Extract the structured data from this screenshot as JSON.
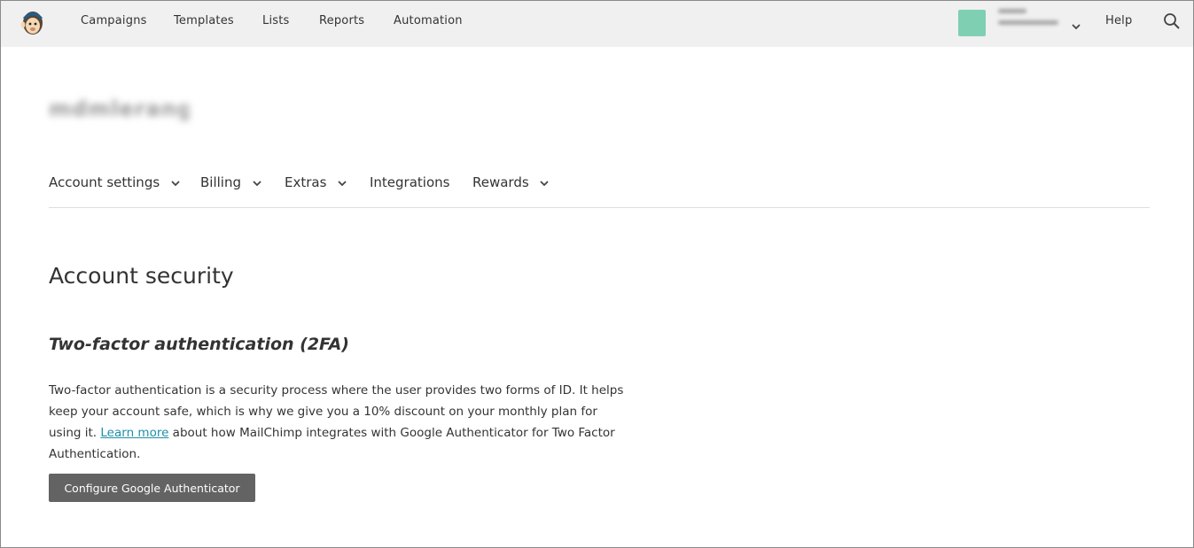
{
  "topnav": {
    "items": [
      "Campaigns",
      "Templates",
      "Lists",
      "Reports",
      "Automation"
    ],
    "help_label": "Help"
  },
  "subnav": {
    "items": [
      "Account settings",
      "Billing",
      "Extras",
      "Integrations",
      "Rewards"
    ]
  },
  "page": {
    "title": "Account security",
    "section_title": "Two-factor authentication (2FA)",
    "body_before_link": "Two-factor authentication is a security process where the user provides two forms of ID. It helps keep your account safe, which is why we give you a 10% discount on your monthly plan for using it. ",
    "link_label": "Learn more",
    "body_after_link": " about how MailChimp integrates with Google Authenticator for Two Factor Authentication.",
    "button_label": "Configure Google Authenticator"
  },
  "colors": {
    "topbar_bg": "#f0f0f0",
    "avatar": "#7fcfb3",
    "link": "#1e8fa8",
    "button_bg": "#636363"
  },
  "icons": [
    "mailchimp-logo-icon",
    "chevron-down-icon",
    "search-icon"
  ]
}
